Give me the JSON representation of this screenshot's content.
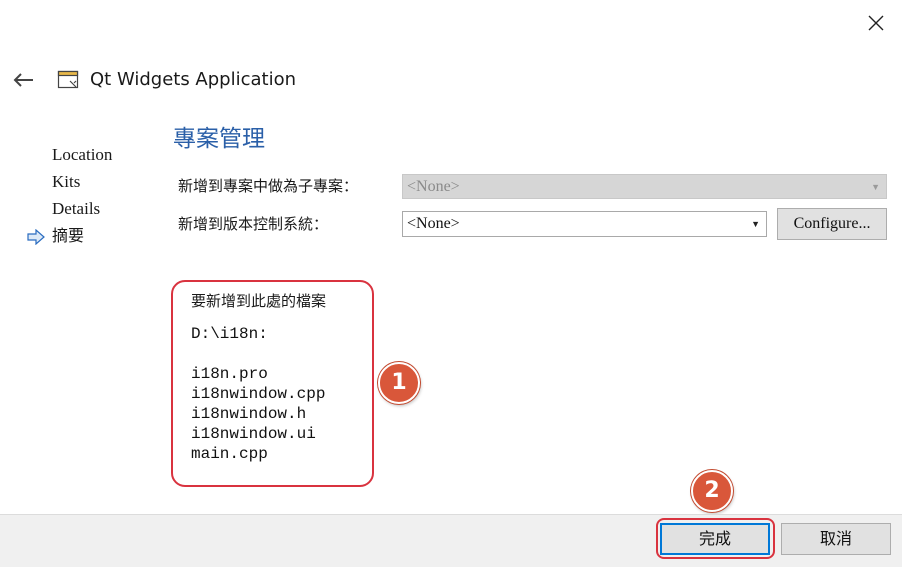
{
  "window": {
    "title": "Qt Widgets Application",
    "close_glyph": "✕",
    "back_glyph": "←"
  },
  "steps": [
    {
      "label": "Location",
      "current": false
    },
    {
      "label": "Kits",
      "current": false
    },
    {
      "label": "Details",
      "current": false
    },
    {
      "label": "摘要",
      "current": true
    }
  ],
  "page": {
    "title": "專案管理",
    "parent_project_label": "新增到專案中做為子專案：",
    "parent_project_value": "<None>",
    "vcs_label": "新增到版本控制系統：",
    "vcs_value": "<None>",
    "configure_label": "Configure...",
    "files_heading": "要新增到此處的檔案",
    "files_dir": "D:\\i18n:",
    "files": [
      "i18n.pro",
      "i18nwindow.cpp",
      "i18nwindow.h",
      "i18nwindow.ui",
      "main.cpp"
    ]
  },
  "annotations": {
    "badge_1": "1",
    "badge_2": "2"
  },
  "footer": {
    "finish_label": "完成",
    "cancel_label": "取消"
  },
  "colors": {
    "accent": "#2a5fa8",
    "annotation_red": "#d9333f",
    "badge_orange": "#d9573a",
    "focus_blue": "#0078d7"
  },
  "icons": {
    "close": "close-icon",
    "back": "back-arrow-icon",
    "app": "qt-widgets-application-icon",
    "current_step": "current-step-arrow-icon",
    "dropdown": "chevron-down-icon"
  }
}
